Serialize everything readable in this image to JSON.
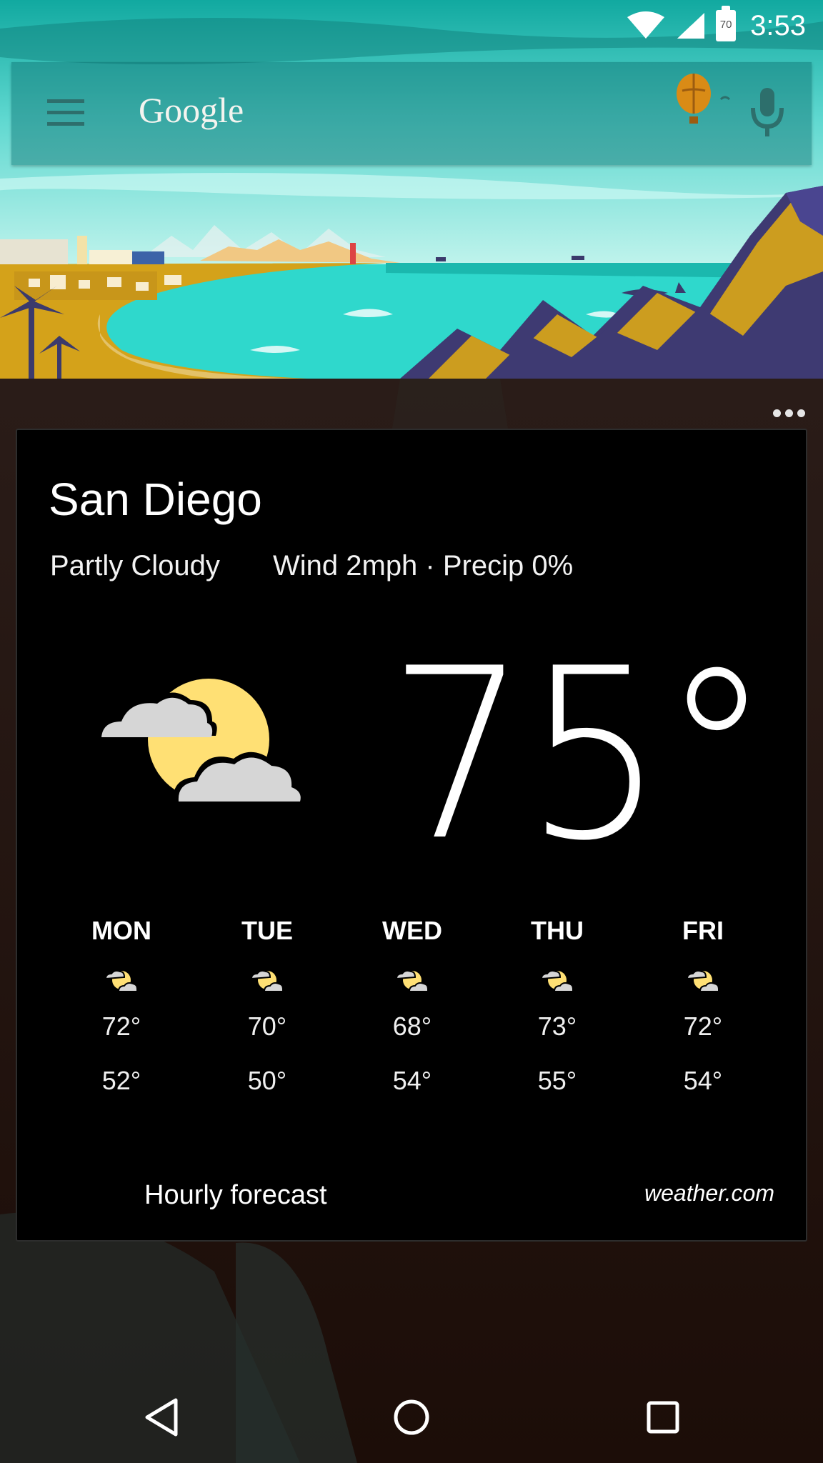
{
  "status_bar": {
    "battery_level": "70",
    "time": "3:53"
  },
  "search": {
    "logo": "Google"
  },
  "weather": {
    "city": "San Diego",
    "condition": "Partly Cloudy",
    "details": "Wind 2mph · Precip 0%",
    "temperature": "75°",
    "icon": "partly-cloudy-icon",
    "forecast": [
      {
        "day": "MON",
        "high": "72°",
        "low": "52°",
        "icon": "partly-cloudy-icon"
      },
      {
        "day": "TUE",
        "high": "70°",
        "low": "50°",
        "icon": "partly-cloudy-icon"
      },
      {
        "day": "WED",
        "high": "68°",
        "low": "54°",
        "icon": "partly-cloudy-icon"
      },
      {
        "day": "THU",
        "high": "73°",
        "low": "55°",
        "icon": "partly-cloudy-icon"
      },
      {
        "day": "FRI",
        "high": "72°",
        "low": "54°",
        "icon": "partly-cloudy-icon"
      }
    ],
    "hourly_link": "Hourly forecast",
    "source": "weather.com"
  },
  "colors": {
    "sea": "#2fd8cc",
    "sand": "#d4a21a",
    "card": "#000000",
    "sun": "#ffe074",
    "cloud": "#d6d6d6"
  },
  "nav": {
    "back": "back-icon",
    "home": "home-icon",
    "recents": "recents-icon"
  }
}
